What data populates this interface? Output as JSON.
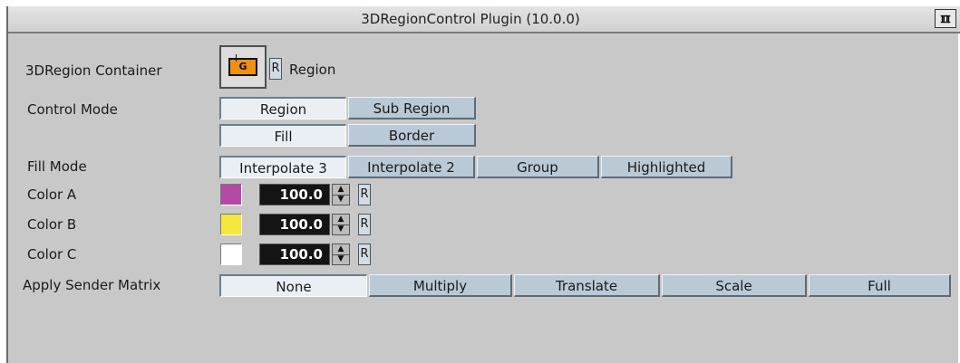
{
  "window": {
    "title": "3DRegionControl Plugin (10.0.0)",
    "icon": "viz-logo-icon",
    "icon_glyph": "ℼ"
  },
  "container": {
    "label": "3DRegion Container",
    "thumbnail_letter": "G",
    "reset_label": "R",
    "value": "Region"
  },
  "control_mode": {
    "label": "Control Mode",
    "row1": [
      "Region",
      "Sub Region"
    ],
    "row1_selected": "Region",
    "row2": [
      "Fill",
      "Border"
    ],
    "row2_selected": "Fill"
  },
  "fill_mode": {
    "label": "Fill Mode",
    "options": [
      "Interpolate 3",
      "Interpolate 2",
      "Group",
      "Highlighted"
    ],
    "selected": "Interpolate 3"
  },
  "colors": [
    {
      "label": "Color A",
      "swatch": "#b54aa6",
      "value": "100.0",
      "reset": "R"
    },
    {
      "label": "Color B",
      "swatch": "#f4e73c",
      "value": "100.0",
      "reset": "R"
    },
    {
      "label": "Color C",
      "swatch": "#ffffff",
      "value": "100.0",
      "reset": "R"
    }
  ],
  "sender_matrix": {
    "label": "Apply Sender Matrix",
    "options": [
      "None",
      "Multiply",
      "Translate",
      "Scale",
      "Full"
    ],
    "selected": "None"
  },
  "theme": {
    "panel_bg": "#c8c8c8",
    "button_bg": "#b9c9d6",
    "button_active_bg": "#e9eff5",
    "field_bg": "#141414"
  }
}
